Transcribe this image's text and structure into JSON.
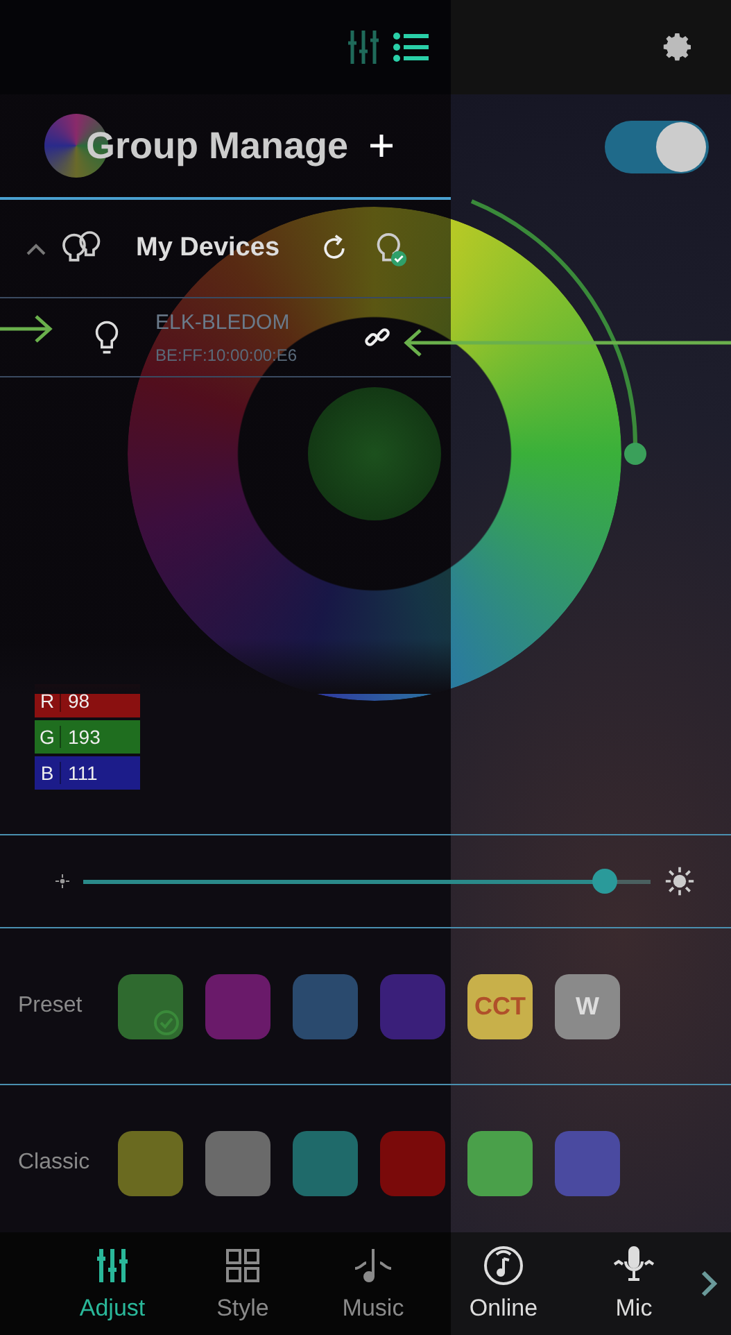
{
  "drawer": {
    "mode_icons": [
      {
        "kind": "sliders",
        "selected": false
      },
      {
        "kind": "list",
        "selected": true
      }
    ],
    "title": "Group Manage",
    "groups": [
      {
        "name": "My Devices",
        "expanded": true,
        "devices": [
          {
            "name": "ELK-BLEDOM",
            "address": "BE:FF:10:00:00:E6",
            "connected": true
          }
        ]
      }
    ]
  },
  "power": {
    "on": true
  },
  "rgb": [
    {
      "channel": "R",
      "value": "98",
      "color": "#8a1010"
    },
    {
      "channel": "G",
      "value": "193",
      "color": "#1f6e1f"
    },
    {
      "channel": "B",
      "value": "111",
      "color": "#1c1c8a"
    }
  ],
  "brightness": {
    "level": 0.92
  },
  "presets": {
    "label": "Preset",
    "swatches": [
      {
        "color": "#2f6a2f",
        "selected": true
      },
      {
        "color": "#6a1a6a",
        "selected": false
      },
      {
        "color": "#2a4a6e",
        "selected": false
      },
      {
        "color": "#3a1f7a",
        "selected": false
      },
      {
        "color": "#c8b04a",
        "text": "CCT",
        "selected": false
      },
      {
        "color": "#8a8a8a",
        "text": "W",
        "selected": false
      }
    ]
  },
  "classic": {
    "label": "Classic",
    "swatches": [
      {
        "color": "#6a6a20",
        "selected": false
      },
      {
        "color": "#6a6a6a",
        "selected": false
      },
      {
        "color": "#1f6a6a",
        "selected": false
      },
      {
        "color": "#7a0a0a",
        "selected": false
      },
      {
        "color": "#4aa04a",
        "selected": false
      },
      {
        "color": "#4a4aa0",
        "selected": false
      }
    ]
  },
  "nav": [
    {
      "kind": "adjust",
      "label": "Adjust",
      "selected": true
    },
    {
      "kind": "style",
      "label": "Style",
      "selected": false
    },
    {
      "kind": "music",
      "label": "Music",
      "selected": false
    },
    {
      "kind": "online",
      "label": "Online",
      "selected": false
    },
    {
      "kind": "mic",
      "label": "Mic",
      "selected": false
    }
  ]
}
